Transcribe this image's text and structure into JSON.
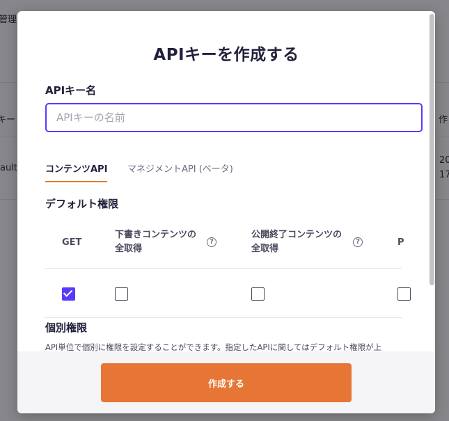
{
  "background": {
    "header_fragment": "管理",
    "col_fragment": "キー",
    "right_col_header": "作",
    "row_left": "ault",
    "row_right_1": "20",
    "row_right_2": "17"
  },
  "modal": {
    "title": "APIキーを作成する",
    "name_label": "APIキー名",
    "name_placeholder": "APIキーの名前",
    "name_value": "",
    "tabs": [
      {
        "label": "コンテンツAPI",
        "active": true
      },
      {
        "label": "マネジメントAPI (ベータ)",
        "active": false
      }
    ],
    "default_permissions": {
      "title": "デフォルト権限",
      "columns": [
        {
          "label": "GET",
          "help": false,
          "checked": true
        },
        {
          "label": "下書きコンテンツの\n全取得",
          "help": true,
          "checked": false
        },
        {
          "label": "公開終了コンテンツの\n全取得",
          "help": true,
          "checked": false
        },
        {
          "label": "P",
          "help": false,
          "checked": false
        }
      ]
    },
    "individual_permissions": {
      "title": "個別権限",
      "description": "API単位で個別に権限を設定することができます。指定したAPIに関してはデフォルト権限が上"
    },
    "submit_label": "作成する",
    "accent_color": "#563bff",
    "button_color": "#e77636",
    "help_icon": "question-circle-icon"
  }
}
